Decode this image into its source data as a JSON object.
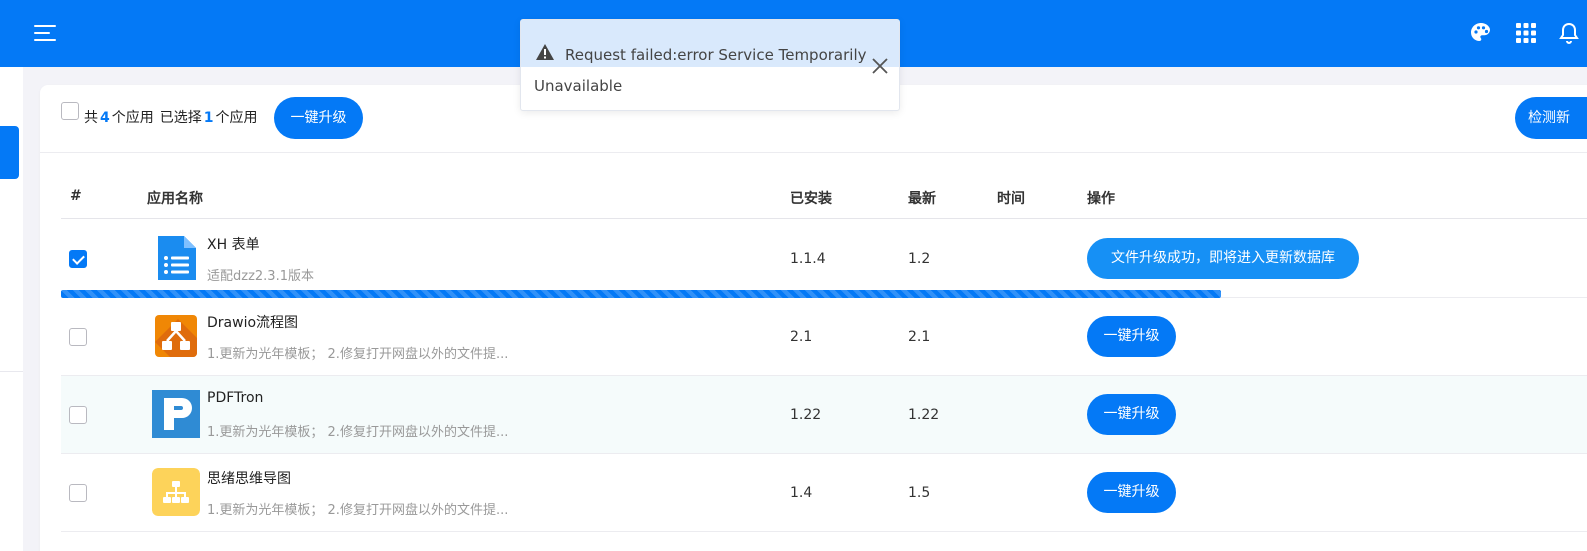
{
  "header": {
    "menu_icon": "hamburger-menu-icon",
    "right_icons": [
      "palette-icon",
      "apps-grid-icon",
      "bell-icon"
    ],
    "brand_color": "#0479f6"
  },
  "toast": {
    "type": "warning",
    "line1": "Request failed:error Service Temporarily",
    "line2": "Unavailable"
  },
  "toolbar": {
    "total_prefix": "共",
    "total_count": "4",
    "total_suffix": "个应用",
    "selected_prefix": "已选择",
    "selected_count": "1",
    "selected_suffix": "个应用",
    "upgrade_all_label": "一键升级",
    "check_label": "检测新"
  },
  "table": {
    "columns": [
      "#",
      "应用名称",
      "已安装",
      "最新",
      "时间",
      "操作"
    ],
    "rows": [
      {
        "name": "XH 表单",
        "desc": "适配dzz2.3.1版本",
        "installed": "1.1.4",
        "latest": "1.2",
        "time": "",
        "action": "文件升级成功，即将进入更新数据库",
        "checked": true,
        "progress": 0.76
      },
      {
        "name": "Drawio流程图",
        "desc": "1.更新为光年模板； 2.修复打开网盘以外的文件提...",
        "installed": "2.1",
        "latest": "2.1",
        "time": "",
        "action": "一键升级",
        "checked": false
      },
      {
        "name": "PDFTron",
        "desc": "1.更新为光年模板； 2.修复打开网盘以外的文件提...",
        "installed": "1.22",
        "latest": "1.22",
        "time": "",
        "action": "一键升级",
        "checked": false
      },
      {
        "name": "思绪思维导图",
        "desc": "1.更新为光年模板； 2.修复打开网盘以外的文件提...",
        "installed": "1.4",
        "latest": "1.5",
        "time": "",
        "action": "一键升级",
        "checked": false
      }
    ]
  }
}
